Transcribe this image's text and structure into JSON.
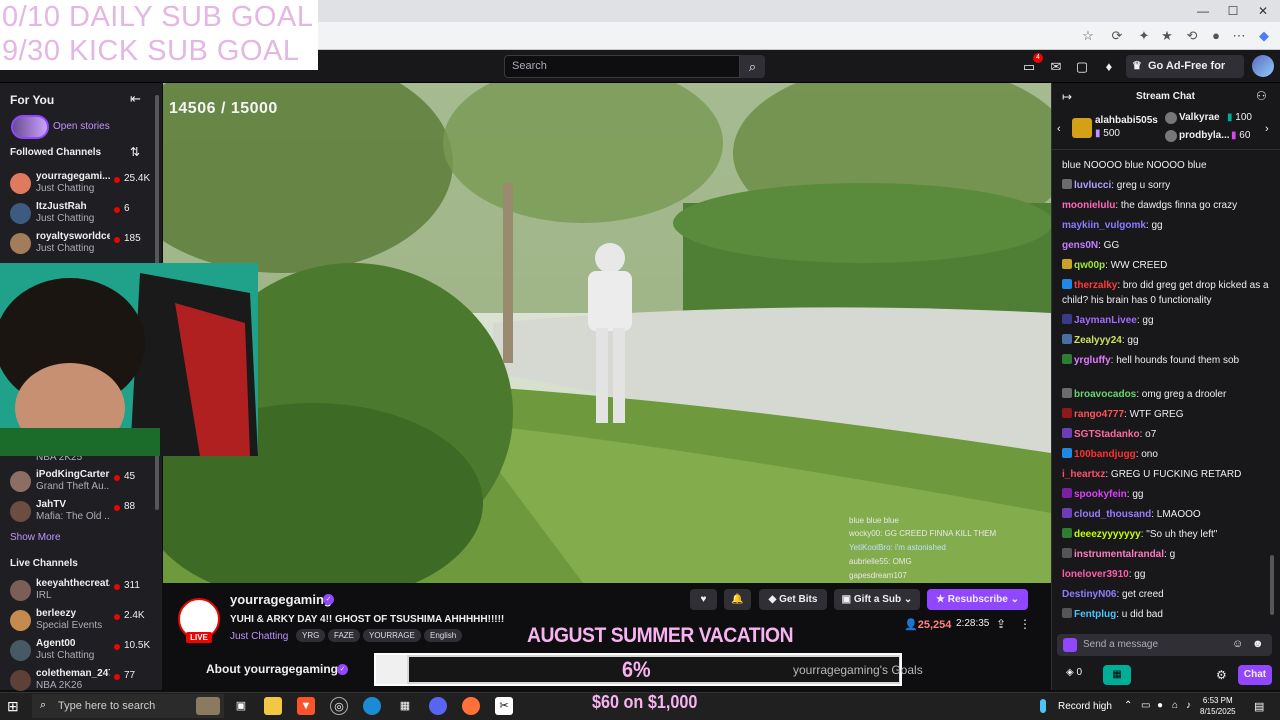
{
  "overlay": {
    "daily_goal": "0/10 DAILY SUB GOAL",
    "kick_goal": "9/30 KICK SUB GOAL",
    "sub_counter": "14506 / 15000",
    "aug_text": "AUGUST SUMMER VACATION",
    "goal_pct": "6%",
    "goal_fraction": 0.06,
    "goal_label": "yourragegaming's Goals",
    "money_text": "$60 on $1,000"
  },
  "topnav": {
    "search_placeholder": "Search",
    "notif_count": "4",
    "adfree_label": "Go Ad-Free for Free"
  },
  "sidebar": {
    "for_you": "For You",
    "open_stories": "Open stories",
    "followed_heading": "Followed Channels",
    "followed": [
      {
        "name": "yourragegami...",
        "cat": "Just Chatting",
        "count": "25.4K",
        "color": "#e07a5f"
      },
      {
        "name": "ItzJustRah",
        "cat": "Just Chatting",
        "count": "6",
        "color": "#3d5a80"
      },
      {
        "name": "royaltysworldceo",
        "cat": "Just Chatting",
        "count": "185",
        "color": "#a37c5b"
      }
    ],
    "hidden_cat": "NBA 2K25",
    "followed_lower": [
      {
        "name": "iPodKingCarter",
        "cat": "Grand Theft Au...",
        "count": "45",
        "color": "#8d6e63"
      },
      {
        "name": "JahTV",
        "cat": "Mafia: The Old ...",
        "count": "88",
        "color": "#6d4c41"
      }
    ],
    "show_more": "Show More",
    "live_heading": "Live Channels",
    "live": [
      {
        "name": "keeyahthecreat...",
        "cat": "IRL",
        "count": "311",
        "color": "#7b5e57"
      },
      {
        "name": "berleezy",
        "cat": "Special Events",
        "count": "2.4K",
        "color": "#c58b4e"
      },
      {
        "name": "Agent00",
        "cat": "Just Chatting",
        "count": "10.5K",
        "color": "#455a64"
      },
      {
        "name": "coletheman_247",
        "cat": "NBA 2K26",
        "count": "77",
        "color": "#5d4037"
      }
    ]
  },
  "video_chat": [
    {
      "text": "blue  blue  blue",
      "color": "#e8e8e8"
    },
    {
      "text": "wocky00: GG CREED FINNA KILL THEM",
      "color": "#e8e8e8"
    },
    {
      "text": "YetiKoolBro: i'm astonished",
      "color": "#bfe0ff"
    },
    {
      "text": "aubrielle55: OMG",
      "color": "#e8e8e8"
    },
    {
      "text": "gapesdream107",
      "color": "#e8e8e8"
    }
  ],
  "stream": {
    "streamer": "yourragegaming",
    "live_label": "LIVE",
    "title": "YUHI & ARKY DAY 4!! GHOST OF TSUSHIMA AHHHHH!!!!!",
    "category": "Just Chatting",
    "tags": [
      "YRG",
      "FAZE",
      "YOURRAGE",
      "English"
    ],
    "get_bits": "Get Bits",
    "gift_sub": "Gift a Sub",
    "resubscribe": "Resubscribe",
    "viewers": "25,254",
    "uptime": "2:28:35",
    "about": "About yourragegaming"
  },
  "chat": {
    "title": "Stream Chat",
    "gifts": [
      {
        "name": "alahbabi505s",
        "count": "500"
      },
      {
        "name": "Valkyrae",
        "count": "100"
      },
      {
        "name": "prodbyla...",
        "count": "60"
      }
    ],
    "messages": [
      {
        "user": "",
        "msg": "blue NOOOO blue NOOOO blue",
        "color": "#efeff1",
        "badge": ""
      },
      {
        "user": "luvlucci",
        "msg": ": greg u sorry",
        "color": "#b1a3ff",
        "badge": "#6b6b6b"
      },
      {
        "user": "moonielulu",
        "msg": ": the dawdgs finna go crazy",
        "color": "#ff69b4",
        "badge": ""
      },
      {
        "user": "maykiin_vulgomk",
        "msg": ": gg",
        "color": "#8a7dff",
        "badge": ""
      },
      {
        "user": "gens0N",
        "msg": ": GG",
        "color": "#c77dff",
        "badge": ""
      },
      {
        "user": "qw00p",
        "msg": ": WW CREED",
        "color": "#a3e635",
        "badge": "#c9a227"
      },
      {
        "user": "therzalky",
        "msg": ": bro did greg get drop kicked as a child? his brain has 0 functionality",
        "color": "#ff3b3b",
        "badge": "#1e88e5"
      },
      {
        "user": "JaymanLivee",
        "msg": ": gg",
        "color": "#a06cff",
        "badge": "#3a3a8a"
      },
      {
        "user": "Zealyyy24",
        "msg": ": gg",
        "color": "#cde45a",
        "badge": "#4a6fa5"
      },
      {
        "user": "yrgluffy",
        "msg": ": hell hounds found them sob",
        "color": "#e47aff",
        "badge": "#2e7d32"
      },
      {
        "user": "broavocados",
        "msg": ": omg greg a drooler",
        "color": "#64d86b",
        "badge": "#6b6b6b"
      },
      {
        "user": "rango4777",
        "msg": ": WTF GREG",
        "color": "#ff5252",
        "badge": "#8b1a1a"
      },
      {
        "user": "SGTStadanko",
        "msg": ": o7",
        "color": "#ff6b9a",
        "badge": "#6a3fb5"
      },
      {
        "user": "100bandjugg",
        "msg": ": ono",
        "color": "#ff3030",
        "badge": "#1e88e5"
      },
      {
        "user": "i_heartxz",
        "msg": ": GREG U FUCKING RETARD",
        "color": "#ff4d6d",
        "badge": ""
      },
      {
        "user": "spookyfein",
        "msg": ": gg",
        "color": "#e040fb",
        "badge": "#7b1fa2"
      },
      {
        "user": "cloud_thousand",
        "msg": ": LMAOOO",
        "color": "#9b7bff",
        "badge": "#6a3fb5"
      },
      {
        "user": "deeezyyyyyyy",
        "msg": ": \"So uh they left\"",
        "color": "#c6ff00",
        "badge": "#2e7d32"
      },
      {
        "user": "instrumentalrandal",
        "msg": ": g",
        "color": "#ff7bc2",
        "badge": "#555"
      },
      {
        "user": "lonelover3910",
        "msg": ": gg",
        "color": "#ff5ca8",
        "badge": ""
      },
      {
        "user": "DestinyN06",
        "msg": ": get creed",
        "color": "#8e7dff",
        "badge": ""
      },
      {
        "user": "Fentplug",
        "msg": ": u did bad",
        "color": "#4fc3f7",
        "badge": "#555"
      }
    ],
    "input_placeholder": "Send a message",
    "points": "0",
    "chat_button": "Chat"
  },
  "taskbar": {
    "search_placeholder": "Type here to search",
    "record_high": "Record high",
    "time": "6:53 PM",
    "date": "8/15/2025"
  }
}
